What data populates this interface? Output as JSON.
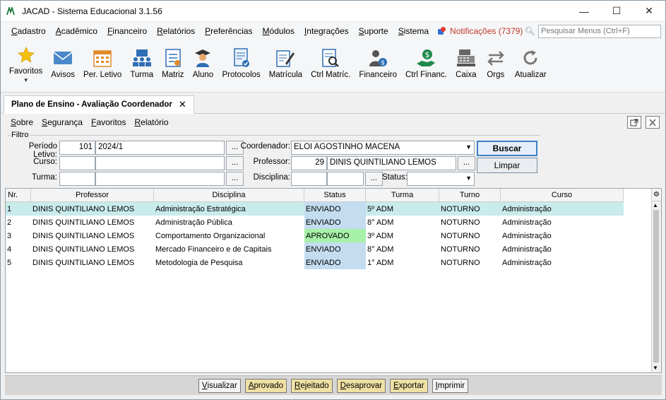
{
  "window": {
    "title": "JACAD - Sistema Educacional 3.1.56",
    "minimize": "—",
    "maximize": "☐",
    "close": "✕"
  },
  "menu": {
    "items": [
      {
        "ul": "C",
        "rest": "adastro"
      },
      {
        "ul": "A",
        "rest": "cadêmico"
      },
      {
        "ul": "F",
        "rest": "inanceiro"
      },
      {
        "ul": "R",
        "rest": "elatórios"
      },
      {
        "ul": "P",
        "rest": "referências"
      },
      {
        "ul": "M",
        "rest": "ódulos"
      },
      {
        "ul": "I",
        "rest": "ntegrações"
      },
      {
        "ul": "S",
        "rest": "uporte"
      },
      {
        "ul": "S",
        "rest": "istema"
      }
    ],
    "notifications": "Notificações (7379)",
    "search_placeholder": "Pesquisar Menus (Ctrl+F)"
  },
  "toolbar": {
    "items": [
      {
        "label": "Favoritos",
        "icon": "star-icon"
      },
      {
        "label": "Avisos",
        "icon": "envelope-icon"
      },
      {
        "label": "Per. Letivo",
        "icon": "calendar-icon"
      },
      {
        "label": "Turma",
        "icon": "class-icon"
      },
      {
        "label": "Matriz",
        "icon": "matrix-icon"
      },
      {
        "label": "Aluno",
        "icon": "student-icon"
      },
      {
        "label": "Protocolos",
        "icon": "protocol-icon"
      },
      {
        "label": "Matrícula",
        "icon": "enrollment-icon"
      },
      {
        "label": "Ctrl Matríc.",
        "icon": "enrollment-control-icon"
      },
      {
        "label": "Financeiro",
        "icon": "finance-icon"
      },
      {
        "label": "Ctrl Financ.",
        "icon": "finance-control-icon"
      },
      {
        "label": "Caixa",
        "icon": "cash-register-icon"
      },
      {
        "label": "Orgs",
        "icon": "swap-icon"
      },
      {
        "label": "Atualizar",
        "icon": "refresh-icon"
      }
    ]
  },
  "tab": {
    "title": "Plano de Ensino - Avaliação Coordenador",
    "close": "✕"
  },
  "inner_menu": {
    "items": [
      {
        "ul": "S",
        "rest": "obre"
      },
      {
        "ul": "S",
        "rest": "egurança"
      },
      {
        "ul": "F",
        "rest": "avoritos"
      },
      {
        "ul": "R",
        "rest": "elatório"
      }
    ]
  },
  "filter": {
    "legend": "Filtro",
    "periodo_label": "Período Letivo:",
    "periodo_code": "101",
    "periodo_name": "2024/1",
    "curso_label": "Curso:",
    "turma_label": "Turma:",
    "coordenador_label": "Coordenador:",
    "coordenador_value": "ELOI AGOSTINHO MACENA",
    "professor_label": "Professor:",
    "professor_code": "29",
    "professor_name": "DINIS QUINTILIANO LEMOS",
    "disciplina_label": "Disciplina:",
    "status_label": "Status:",
    "dots": "...",
    "buscar": "Buscar",
    "limpar": "Limpar"
  },
  "grid": {
    "columns": [
      "Nr.",
      "Professor",
      "Disciplina",
      "Status",
      "Turma",
      "Turno",
      "Curso"
    ],
    "rows": [
      {
        "nr": "1",
        "professor": "DINIS QUINTILIANO LEMOS",
        "disciplina": "Administração Estratégica",
        "status": "ENVIADO",
        "turma": "5º ADM",
        "turno": "NOTURNO",
        "curso": "Administração"
      },
      {
        "nr": "2",
        "professor": "DINIS QUINTILIANO LEMOS",
        "disciplina": "Administração Pública",
        "status": "ENVIADO",
        "turma": "8° ADM",
        "turno": "NOTURNO",
        "curso": "Administração"
      },
      {
        "nr": "3",
        "professor": "DINIS QUINTILIANO LEMOS",
        "disciplina": "Comportamento Organizacional",
        "status": "APROVADO",
        "turma": "3º ADM",
        "turno": "NOTURNO",
        "curso": "Administração"
      },
      {
        "nr": "4",
        "professor": "DINIS QUINTILIANO LEMOS",
        "disciplina": "Mercado Financeiro e de Capitais",
        "status": "ENVIADO",
        "turma": "8° ADM",
        "turno": "NOTURNO",
        "curso": "Administração"
      },
      {
        "nr": "5",
        "professor": "DINIS QUINTILIANO LEMOS",
        "disciplina": "Metodologia de Pesquisa",
        "status": "ENVIADO",
        "turma": "1° ADM",
        "turno": "NOTURNO",
        "curso": "Administração"
      }
    ]
  },
  "actions": {
    "visualizar": {
      "ul": "V",
      "rest": "isualizar"
    },
    "aprovado": {
      "ul": "A",
      "rest": "provado"
    },
    "rejeitado": {
      "ul": "R",
      "rest": "ejeitado"
    },
    "desaprovar": {
      "ul": "D",
      "rest": "esaprovar"
    },
    "exportar": {
      "ul": "E",
      "rest": "xportar"
    },
    "imprimir": {
      "ul": "I",
      "rest": "mprimir"
    }
  },
  "colors": {
    "selected_row": "#c9ebeb",
    "status_enviado": "#c3dcef",
    "status_aprovado": "#a7f0a7",
    "notifications": "#c0392b",
    "button_yellow": "#efe0a4"
  }
}
